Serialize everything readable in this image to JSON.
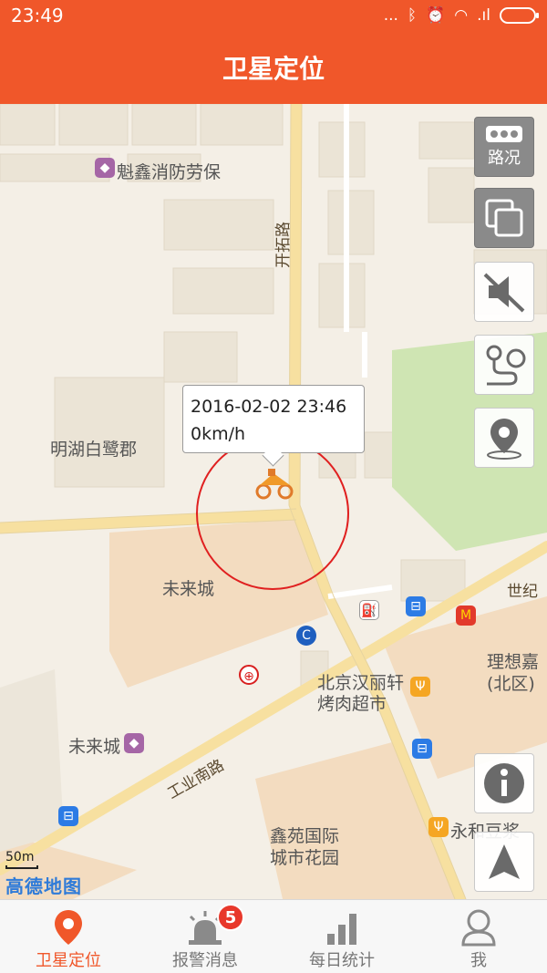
{
  "status_bar": {
    "time": "23:49",
    "dots": "...",
    "signal_text": ".ıl"
  },
  "title": "卫星定位",
  "map": {
    "labels": {
      "poi_kuixin": "魁鑫消防劳保",
      "road_kaituo": "开拓路",
      "minghu": "明湖白鹭郡",
      "weilaicheng_1": "未来城",
      "weilaicheng_2": "未来城",
      "road_gongyenan": "工业南路",
      "hanlixuan_1": "北京汉丽轩",
      "hanlixuan_2": "烤肉超市",
      "shiji": "世纪",
      "lixiangjia_1": "理想嘉",
      "lixiangjia_2": "(北区)",
      "xinyuan_1": "鑫苑国际",
      "xinyuan_2": "城市花园",
      "yonghe": "永和豆浆"
    },
    "bubble": {
      "datetime": "2016-02-02 23:46",
      "speed": "0km/h"
    },
    "controls": {
      "traffic_label": "路况"
    },
    "scale": "50m",
    "logo": "高德地图"
  },
  "bottom_nav": {
    "items": [
      {
        "label": "卫星定位",
        "active": true
      },
      {
        "label": "报警消息",
        "badge": "5"
      },
      {
        "label": "每日统计"
      },
      {
        "label": "我"
      }
    ]
  },
  "colors": {
    "accent": "#f0572a",
    "badge": "#e8382b",
    "park": "#cfe5b3"
  }
}
